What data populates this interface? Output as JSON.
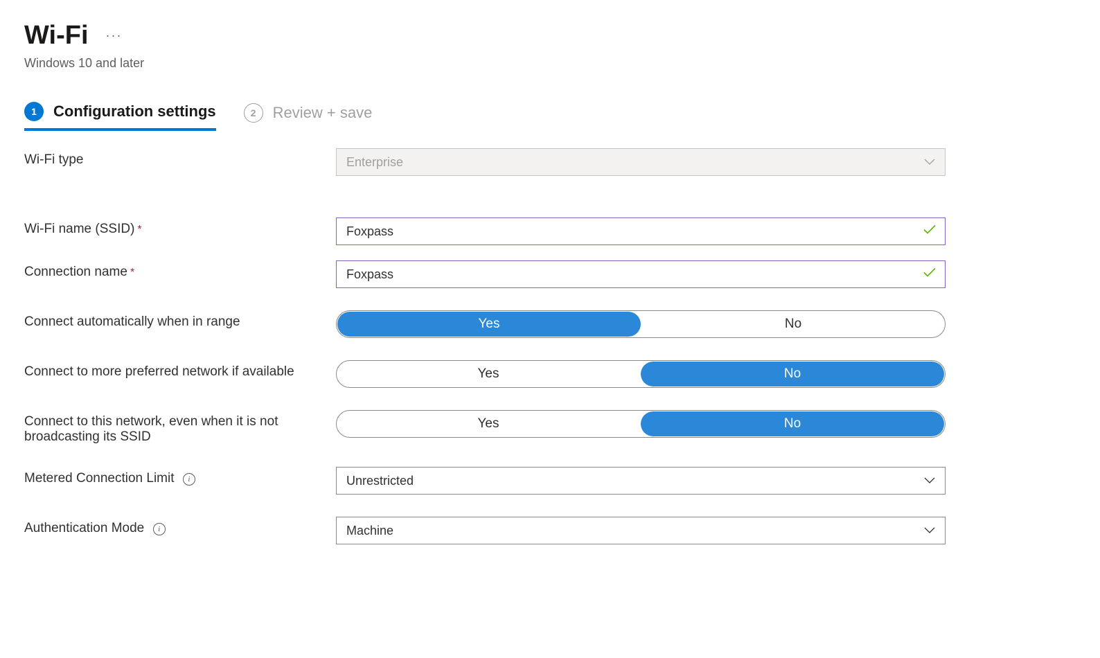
{
  "header": {
    "title": "Wi-Fi",
    "subtitle": "Windows 10 and later"
  },
  "tabs": [
    {
      "number": "1",
      "label": "Configuration settings",
      "active": true
    },
    {
      "number": "2",
      "label": "Review + save",
      "active": false
    }
  ],
  "fields": {
    "wifi_type": {
      "label": "Wi-Fi type",
      "value": "Enterprise"
    },
    "ssid": {
      "label": "Wi-Fi name (SSID)",
      "value": "Foxpass",
      "required": true
    },
    "connection_name": {
      "label": "Connection name",
      "value": "Foxpass",
      "required": true
    },
    "connect_auto": {
      "label": "Connect automatically when in range",
      "options": {
        "yes": "Yes",
        "no": "No"
      },
      "selected": "yes"
    },
    "connect_preferred": {
      "label": "Connect to more preferred network if available",
      "options": {
        "yes": "Yes",
        "no": "No"
      },
      "selected": "no"
    },
    "connect_hidden": {
      "label": "Connect to this network, even when it is not broadcasting its SSID",
      "options": {
        "yes": "Yes",
        "no": "No"
      },
      "selected": "no"
    },
    "metered": {
      "label": "Metered Connection Limit",
      "value": "Unrestricted"
    },
    "auth_mode": {
      "label": "Authentication Mode",
      "value": "Machine"
    }
  }
}
